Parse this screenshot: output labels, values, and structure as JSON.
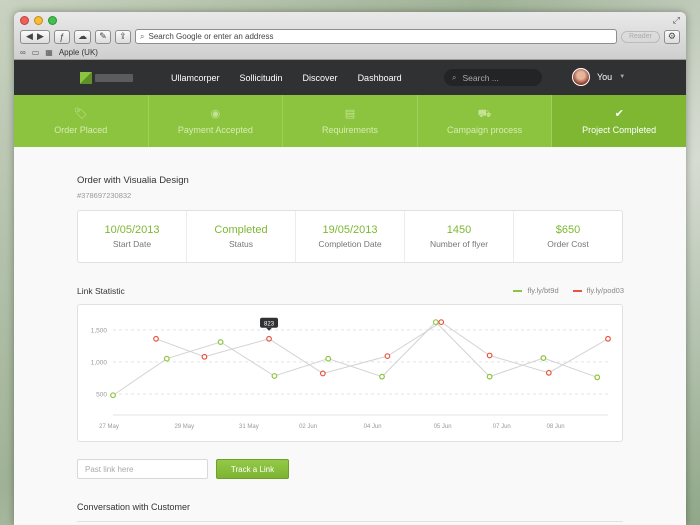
{
  "browser": {
    "address_placeholder": "Search Google or enter an address",
    "reader_label": "Reader",
    "bookmark_label": "Apple (UK)"
  },
  "header": {
    "nav": [
      "Ullamcorper",
      "Sollicitudin",
      "Discover",
      "Dashboard"
    ],
    "search_placeholder": "Search ...",
    "user_name": "You"
  },
  "steps": [
    {
      "label": "Order Placed",
      "icon": "tag-icon",
      "active": false
    },
    {
      "label": "Payment Accepted",
      "icon": "coin-icon",
      "active": false
    },
    {
      "label": "Requirements",
      "icon": "inbox-icon",
      "active": false
    },
    {
      "label": "Campaign process",
      "icon": "truck-icon",
      "active": false
    },
    {
      "label": "Project Completed",
      "icon": "check-icon",
      "active": true
    }
  ],
  "order": {
    "title": "Order with Visualia Design",
    "id": "#378697230832",
    "stats": [
      {
        "value": "10/05/2013",
        "label": "Start Date"
      },
      {
        "value": "Completed",
        "label": "Status"
      },
      {
        "value": "19/05/2013",
        "label": "Completion Date"
      },
      {
        "value": "1450",
        "label": "Number of flyer"
      },
      {
        "value": "$650",
        "label": "Order Cost"
      }
    ]
  },
  "link_statistic": {
    "title": "Link Statistic",
    "legend": [
      {
        "name": "fly.ly/bt9d",
        "color": "#8cc43f"
      },
      {
        "name": "fly.ly/pod03",
        "color": "#e8543f"
      }
    ]
  },
  "chart_data": {
    "type": "line",
    "title": "Link Statistic",
    "x_ticks": [
      "27 May",
      "29 May",
      "31 May",
      "02 Jun",
      "04 Jun",
      "05 Jun",
      "07 Jun",
      "08 Jun"
    ],
    "y_ticks": [
      "1,500",
      "1,000",
      "500"
    ],
    "ylim": [
      250,
      1700
    ],
    "grid": true,
    "legend_position": "top-right",
    "tooltip": {
      "series": "fly.ly/pod03",
      "value": "823"
    },
    "series": [
      {
        "name": "fly.ly/bt9d",
        "color": "#8cc43f",
        "points": [
          [
            0,
            480
          ],
          [
            1,
            1050
          ],
          [
            2,
            1310
          ],
          [
            3,
            780
          ],
          [
            4,
            1050
          ],
          [
            5,
            770
          ],
          [
            6,
            1620
          ],
          [
            7,
            770
          ],
          [
            8,
            1060
          ],
          [
            9,
            760
          ]
        ]
      },
      {
        "name": "fly.ly/pod03",
        "color": "#e8543f",
        "points": [
          [
            0.8,
            1360
          ],
          [
            1.7,
            1080
          ],
          [
            2.9,
            1360
          ],
          [
            3.9,
            820
          ],
          [
            5.1,
            1090
          ],
          [
            6.1,
            1620
          ],
          [
            7,
            1100
          ],
          [
            8.1,
            830
          ],
          [
            9.2,
            1360
          ]
        ]
      }
    ],
    "x_index_range": [
      0,
      9.2
    ]
  },
  "tracker": {
    "placeholder": "Past link here",
    "button_label": "Track a Link"
  },
  "conversation": {
    "title": "Conversation with Customer"
  }
}
